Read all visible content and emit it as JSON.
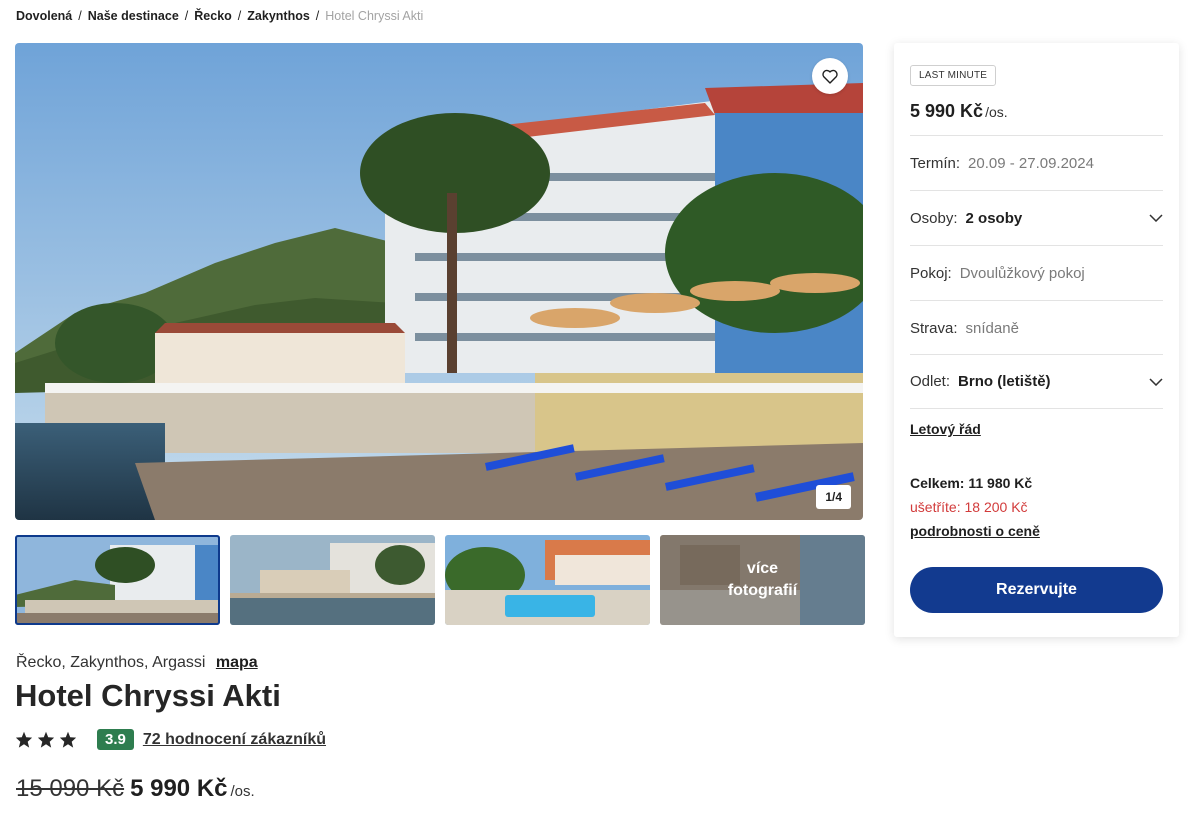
{
  "breadcrumb": {
    "items": [
      "Dovolená",
      "Naše destinace",
      "Řecko",
      "Zakynthos"
    ],
    "current": "Hotel Chryssi Akti",
    "separator": "/"
  },
  "gallery": {
    "counter": "1/4",
    "more_label_line1": "více",
    "more_label_line2": "fotografií",
    "favorite_icon": "heart-icon"
  },
  "hotel": {
    "location": "Řecko, Zakynthos, Argassi",
    "map_link": "mapa",
    "name": "Hotel Chryssi Akti",
    "stars": 3,
    "rating": "3.9",
    "reviews": "72 hodnocení zákazníků",
    "old_price": "15 090 Kč",
    "price": "5 990 Kč",
    "per_person": "/os."
  },
  "booking": {
    "badge": "LAST MINUTE",
    "price": "5 990 Kč",
    "per_person": "/os.",
    "term_label": "Termín:",
    "term_value": "20.09 - 27.09.2024",
    "persons_label": "Osoby:",
    "persons_value": "2 osoby",
    "room_label": "Pokoj:",
    "room_value": "Dvoulůžkový pokoj",
    "board_label": "Strava:",
    "board_value": "snídaně",
    "departure_label": "Odlet:",
    "departure_value": "Brno (letiště)",
    "flight_schedule": "Letový řád",
    "total_label": "Celkem:",
    "total_value": "11 980 Kč",
    "save_label": "ušetříte:",
    "save_value": "18 200 Kč",
    "price_details": "podrobnosti o ceně",
    "book_button": "Rezervujte"
  },
  "colors": {
    "primary": "#123a8f",
    "rating_badge": "#2e7d4f",
    "savings": "#d23b3b"
  }
}
